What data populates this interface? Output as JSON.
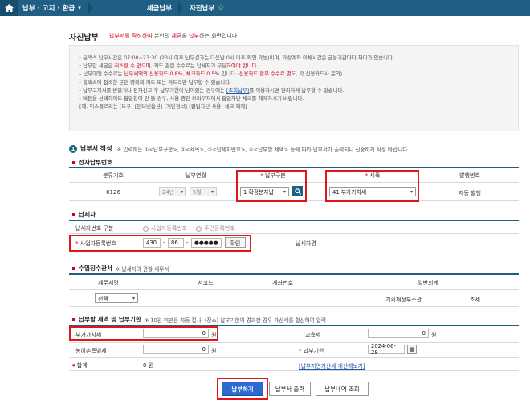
{
  "nav": {
    "menu1": "납부 · 고지 · 환급",
    "menu2": "세금납부",
    "menu3": "자진납부"
  },
  "page": {
    "title": "자진납부",
    "desc_red": "납부서를 작성하여",
    "desc_mid1": " 본인의 ",
    "desc_red2": "세금",
    "desc_mid2": "을 ",
    "desc_red3": "납부",
    "desc_end": "하는 화면입니다."
  },
  "info": {
    "l1": "· 온택스 납부시간은 07:00~23:30 (23시 이후 납부결과는 다음날 0시 이후 확인 가능)이며, 가상계좌 이체시간은 금융기관마다 차이가 있습니다.",
    "l2a": "· 납부한 세금은 ",
    "l2b": "취소할 수 없으며",
    "l2c": ", 카드 관련 수수료는 납세자가 부담",
    "l2d": "하여야 합니다.",
    "l3a": "  - 납부대행 수수료는 ",
    "l3b": "납부세액의 신용카드 0.8%, 체크카드 0.5%",
    "l3c": " 입니다 ",
    "l3d": "(신용카드 할부 수수료 별도",
    "l3e": ", 각 신용카드사 문의)",
    "l4": "· 홈택스에 접속한 본인 명의의 카드 또는 카드로만 납부할 수 있습니다.",
    "l5a": "· 납부고지서를 받았거나 전자신고 후 납부기한이 남아있는 경우에는 ",
    "l5b": "[조회납부]",
    "l5c": "를 이용하시면 편리하게   납부할 수 있습니다.",
    "l6": "· 버튼을 선택하여도 팝업창이 안 뜰 경우, 사용 중인 브라우저에서 팝업차단 체크를 해제하시기 바랍니다.",
    "l7": "  [예. 익스플로러는 [도구]-[인터넷옵션]-[개인정보]-[팝업차단 사용] 체크 해제]"
  },
  "section1": {
    "title": "납부서 작성",
    "note": "※ 입력하는 ①<납부구분>, ②<세목>, ③<납세자번호>, ④<납부할 세액> 등에 따라 납부서가 출력되니 신중하게 작성 바랍니다.",
    "sub": "전자납부번호",
    "headers": [
      "분류기호",
      "납부연월",
      "납부구분",
      "세목",
      "발행번호"
    ],
    "class_code": "0126",
    "year": "24년",
    "month": "5월",
    "payment_type": "1 확정분자납",
    "tax_item": "41 부가가치세",
    "issue_no": "자동 발행",
    "required_mark": "*"
  },
  "taxpayer": {
    "sub": "납세자",
    "type_label": "납세자번호 구분",
    "radio1": "사업자등록번호",
    "radio2": "주민등록번호",
    "brn_label": "사업자등록번호",
    "brn1": "430",
    "brn2": "86",
    "brn3": "●●●●●",
    "confirm": "확인",
    "name_label": "납세자명",
    "dash": "-"
  },
  "account": {
    "sub": "수입징수관서",
    "note": "※ 납세자의 관할 세무서",
    "headers": [
      "세무서명",
      "서코드",
      "계좌번호",
      "일반회계"
    ],
    "office": "선택",
    "account_name": "기획재정부소관",
    "account_type": "조세"
  },
  "amount": {
    "sub": "납부할 세액 및 납부기한",
    "note": "※ 10원 미만은 자동 절사, (장소) 납부기한이 경과한 경우 가산세를 합산하여 입력",
    "vat_label": "부가가치세",
    "vat": "0",
    "edu_label": "교육세",
    "edu": "0",
    "farm_label": "농어촌특별세",
    "farm": "0",
    "due_label": "납부기한",
    "due": "2024-06-28",
    "total_label": "합계",
    "total": "0",
    "won": "원",
    "link": "[납부지연가산세 계산해보기]"
  },
  "buttons": {
    "pay": "납부하기",
    "print": "납부서 출력",
    "history": "납부내역 조회"
  }
}
